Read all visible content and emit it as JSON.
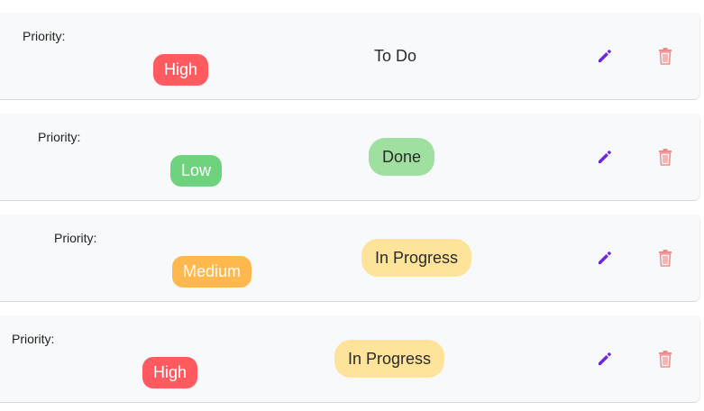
{
  "colors": {
    "high": "#ff5a5f",
    "low": "#6fd37e",
    "medium": "#ffb84d",
    "done": "#9fdf9f",
    "in_progress": "#fde49a",
    "edit_icon": "#6a2bd9",
    "delete_icon": "#f08a8a"
  },
  "tasks": [
    {
      "priority_label": "Priority:",
      "priority": "High",
      "status": "To Do"
    },
    {
      "priority_label": "Priority:",
      "priority": "Low",
      "status": "Done"
    },
    {
      "priority_label": "Priority:",
      "priority": "Medium",
      "status": "In Progress"
    },
    {
      "priority_label": "Priority:",
      "priority": "High",
      "status": "In Progress"
    }
  ],
  "icons": {
    "edit": "pencil-icon",
    "delete": "trash-icon"
  }
}
